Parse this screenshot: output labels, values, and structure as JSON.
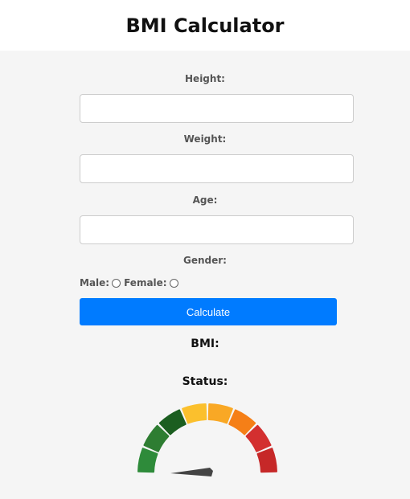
{
  "header": {
    "title": "BMI Calculator"
  },
  "form": {
    "height_label": "Height:",
    "height_value": "",
    "weight_label": "Weight:",
    "weight_value": "",
    "age_label": "Age:",
    "age_value": "",
    "gender_label": "Gender:",
    "male_label": "Male:",
    "female_label": "Female:",
    "calculate_label": "Calculate"
  },
  "results": {
    "bmi_label": "BMI:",
    "status_label": "Status:"
  },
  "gauge": {
    "segment_colors": [
      "#2e8b3a",
      "#2e7d32",
      "#1b5e20",
      "#fbc02d",
      "#f9a825",
      "#f57f17",
      "#d32f2f",
      "#c62828"
    ],
    "needle_color": "#444444"
  },
  "colors": {
    "accent": "#007bff",
    "panel_background": "#f5f5f5"
  }
}
